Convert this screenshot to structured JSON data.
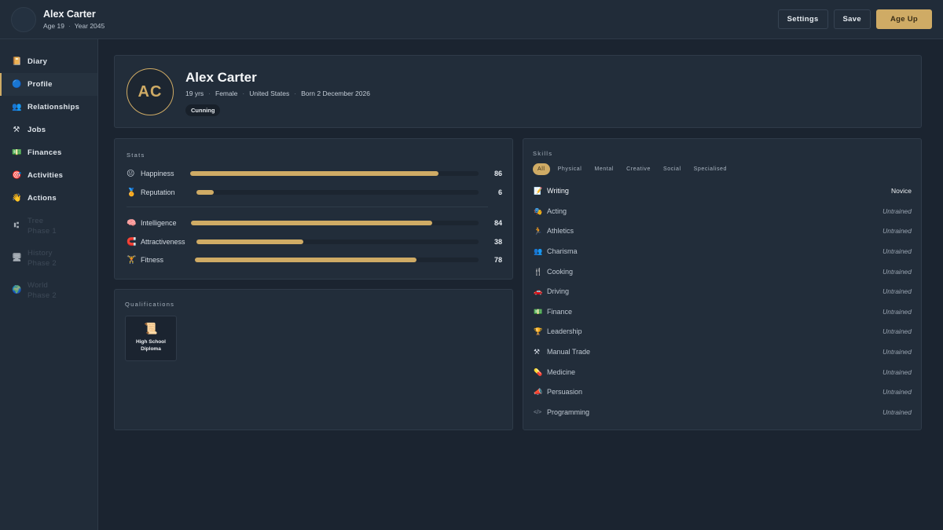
{
  "header": {
    "name": "Alex Carter",
    "age": "Age 19",
    "year": "Year 2045",
    "settings_label": "Settings",
    "save_label": "Save",
    "ageup_label": "Age Up"
  },
  "sidebar": {
    "items": [
      {
        "label": "Diary",
        "icon": "📔"
      },
      {
        "label": "Profile",
        "icon": "🔵"
      },
      {
        "label": "Relationships",
        "icon": "👥"
      },
      {
        "label": "Jobs",
        "icon": "⚒"
      },
      {
        "label": "Finances",
        "icon": "💵"
      },
      {
        "label": "Activities",
        "icon": "🎯"
      },
      {
        "label": "Actions",
        "icon": "👋"
      }
    ],
    "locked": [
      {
        "label": "Tree",
        "phase": "Phase 1",
        "icon": "⑆"
      },
      {
        "label": "History",
        "phase": "Phase 2",
        "icon": "🖥"
      },
      {
        "label": "World",
        "phase": "Phase 2",
        "icon": "🌍"
      }
    ]
  },
  "profile": {
    "initials": "AC",
    "name": "Alex Carter",
    "age": "19 yrs",
    "gender": "Female",
    "country": "United States",
    "born": "Born 2 December 2026",
    "trait": "Cunning"
  },
  "stats": {
    "title": "Stats",
    "items": [
      {
        "label": "Happiness",
        "value": 86,
        "icon": "😐"
      },
      {
        "label": "Reputation",
        "value": 6,
        "icon": "🏅"
      },
      {
        "label": "Intelligence",
        "value": 84,
        "icon": "🧠"
      },
      {
        "label": "Attractiveness",
        "value": 38,
        "icon": "🧲"
      },
      {
        "label": "Fitness",
        "value": 78,
        "icon": "🏋"
      }
    ]
  },
  "qualifications": {
    "title": "Qualifications",
    "items": [
      {
        "label": "High School Diploma",
        "icon": "📜"
      }
    ]
  },
  "skills": {
    "title": "Skills",
    "filters": [
      "All",
      "Physical",
      "Mental",
      "Creative",
      "Social",
      "Specialised"
    ],
    "items": [
      {
        "label": "Writing",
        "level": "Novice",
        "icon": "📝"
      },
      {
        "label": "Acting",
        "level": "Untrained",
        "icon": "🎭"
      },
      {
        "label": "Athletics",
        "level": "Untrained",
        "icon": "🏃"
      },
      {
        "label": "Charisma",
        "level": "Untrained",
        "icon": "👥"
      },
      {
        "label": "Cooking",
        "level": "Untrained",
        "icon": "🍴"
      },
      {
        "label": "Driving",
        "level": "Untrained",
        "icon": "🚗"
      },
      {
        "label": "Finance",
        "level": "Untrained",
        "icon": "💵"
      },
      {
        "label": "Leadership",
        "level": "Untrained",
        "icon": "🏆"
      },
      {
        "label": "Manual Trade",
        "level": "Untrained",
        "icon": "⚒"
      },
      {
        "label": "Medicine",
        "level": "Untrained",
        "icon": "💊"
      },
      {
        "label": "Persuasion",
        "level": "Untrained",
        "icon": "📣"
      },
      {
        "label": "Programming",
        "level": "Untrained",
        "icon": "</>"
      }
    ]
  }
}
